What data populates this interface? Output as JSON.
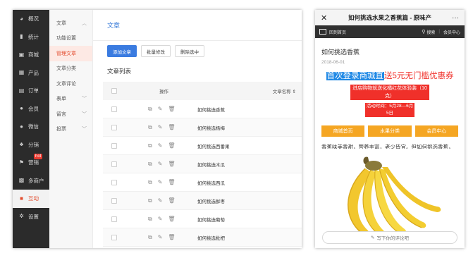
{
  "admin": {
    "primary_nav": [
      {
        "label": "概况",
        "icon": "gauge-icon"
      },
      {
        "label": "统计",
        "icon": "bar-chart-icon"
      },
      {
        "label": "商城",
        "icon": "store-icon"
      },
      {
        "label": "产品",
        "icon": "grid-icon"
      },
      {
        "label": "订单",
        "icon": "order-icon"
      },
      {
        "label": "会员",
        "icon": "member-icon"
      },
      {
        "label": "微信",
        "icon": "wechat-icon"
      },
      {
        "label": "分销",
        "icon": "distribution-icon"
      },
      {
        "label": "营销",
        "icon": "flag-icon",
        "badge": "hot"
      },
      {
        "label": "多商户",
        "icon": "merchant-icon"
      },
      {
        "label": "互动",
        "icon": "interaction-icon",
        "active": true
      },
      {
        "label": "设置",
        "icon": "gear-icon"
      }
    ],
    "secondary_nav": [
      {
        "label": "文章",
        "chevron": "up"
      },
      {
        "label": "功能设置"
      },
      {
        "label": "管理文章",
        "active": true
      },
      {
        "label": "文章分类"
      },
      {
        "label": "文章评论"
      },
      {
        "label": "表单",
        "chevron": "down"
      },
      {
        "label": "留言",
        "chevron": "down"
      },
      {
        "label": "投票",
        "chevron": "down"
      }
    ],
    "main": {
      "title": "文章",
      "toolbar": {
        "add_label": "添加文章",
        "batch_label": "批量修改",
        "delete_label": "删除选中"
      },
      "list_title": "文章列表",
      "table": {
        "col_op": "操作",
        "col_name": "文章名称 ⇕",
        "rows": [
          "如何挑选香蕉",
          "如何挑选杨梅",
          "如何挑选西番果",
          "如何挑选木瓜",
          "如何挑选西瓜",
          "如何挑选鲜枣",
          "如何挑选葡萄",
          "如何挑选枇杷"
        ]
      }
    },
    "accent_color": "#3a7be0",
    "active_color": "#e34c2d"
  },
  "phone": {
    "window_title": "如何挑选水果之香蕉篇 - 原味产",
    "topbar": {
      "home_label": "回到首页",
      "search_label": "搜索",
      "member_label": "会员中心"
    },
    "article": {
      "title": "如何挑选香蕉",
      "date": "2018-06-01",
      "banner_blue": "首次登录商城直",
      "banner_red": "送5元无门槛优惠券",
      "banner_line2": "进店购物就送化橘红花体验装（10克）",
      "banner_line3": "活动时间：5月28—6月5日",
      "categories": [
        "商城首页",
        "水果分类",
        "会员中心"
      ],
      "paragraph": "香蕉味美香甜，营养丰富，老少皆宜。但如何挑选香蕉，还是有些学问的。"
    },
    "comment_placeholder": "写下你的评论吧",
    "category_color": "#f5a623",
    "banner_blue_color": "#1e88e5",
    "banner_red_color": "#f0302a"
  }
}
